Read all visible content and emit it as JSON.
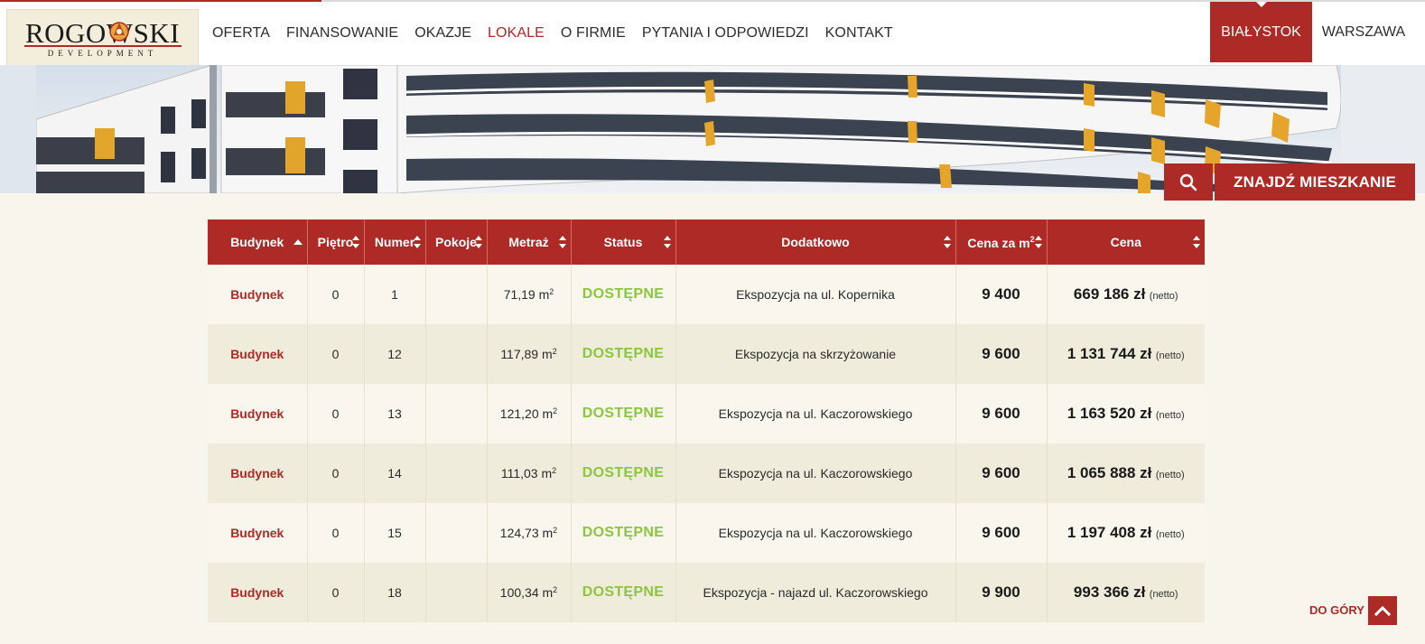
{
  "brand": {
    "name": "ROGOWSKI",
    "tagline": "DEVELOPMENT"
  },
  "colors": {
    "accent": "#ad2a26",
    "status_available": "#8cc63f",
    "page_bg": "#f7f5ec",
    "row_alt": "#efecdb"
  },
  "nav": {
    "items": [
      {
        "label": "OFERTA"
      },
      {
        "label": "FINANSOWANIE"
      },
      {
        "label": "OKAZJE"
      },
      {
        "label": "LOKALE",
        "active": true
      },
      {
        "label": "O FIRMIE"
      },
      {
        "label": "PYTANIA I ODPOWIEDZI"
      },
      {
        "label": "KONTAKT"
      }
    ]
  },
  "cities": {
    "active": "BIAŁYSTOK",
    "other": "WARSZAWA"
  },
  "search": {
    "icon": "search-icon",
    "find_label": "ZNAJDŹ MIESZKANIE"
  },
  "table": {
    "headers": {
      "budynek": "Budynek",
      "pietro": "Piętro",
      "numer": "Numer",
      "pokoje": "Pokoje",
      "metraz": "Metraż",
      "status": "Status",
      "dodatkowo": "Dodatkowo",
      "cena_m2": "Cena za m",
      "cena_m2_sup": "2",
      "cena": "Cena"
    },
    "rows": [
      {
        "budynek": "Budynek",
        "pietro": "0",
        "numer": "1",
        "pokoje": "",
        "metraz": "71,19 m",
        "status": "DOSTĘPNE",
        "dodatkowo": "Ekspozycja na ul. Kopernika",
        "cena_m2": "9 400",
        "cena": "669 186 zł",
        "cena_suffix": "(netto)"
      },
      {
        "budynek": "Budynek",
        "pietro": "0",
        "numer": "12",
        "pokoje": "",
        "metraz": "117,89 m",
        "status": "DOSTĘPNE",
        "dodatkowo": "Ekspozycja na skrzyżowanie",
        "cena_m2": "9 600",
        "cena": "1 131 744 zł",
        "cena_suffix": "(netto)"
      },
      {
        "budynek": "Budynek",
        "pietro": "0",
        "numer": "13",
        "pokoje": "",
        "metraz": "121,20 m",
        "status": "DOSTĘPNE",
        "dodatkowo": "Ekspozycja na ul. Kaczorowskiego",
        "cena_m2": "9 600",
        "cena": "1 163 520 zł",
        "cena_suffix": "(netto)"
      },
      {
        "budynek": "Budynek",
        "pietro": "0",
        "numer": "14",
        "pokoje": "",
        "metraz": "111,03 m",
        "status": "DOSTĘPNE",
        "dodatkowo": "Ekspozycja na ul. Kaczorowskiego",
        "cena_m2": "9 600",
        "cena": "1 065 888 zł",
        "cena_suffix": "(netto)"
      },
      {
        "budynek": "Budynek",
        "pietro": "0",
        "numer": "15",
        "pokoje": "",
        "metraz": "124,73 m",
        "status": "DOSTĘPNE",
        "dodatkowo": "Ekspozycja na ul. Kaczorowskiego",
        "cena_m2": "9 600",
        "cena": "1 197 408 zł",
        "cena_suffix": "(netto)"
      },
      {
        "budynek": "Budynek",
        "pietro": "0",
        "numer": "18",
        "pokoje": "",
        "metraz": "100,34 m",
        "status": "DOSTĘPNE",
        "dodatkowo": "Ekspozycja - najazd ul. Kaczorowskiego",
        "cena_m2": "9 900",
        "cena": "993 366 zł",
        "cena_suffix": "(netto)"
      }
    ],
    "m2_sup": "2"
  },
  "back_to_top": {
    "label": "DO GÓRY",
    "icon": "chevron-up-icon"
  }
}
